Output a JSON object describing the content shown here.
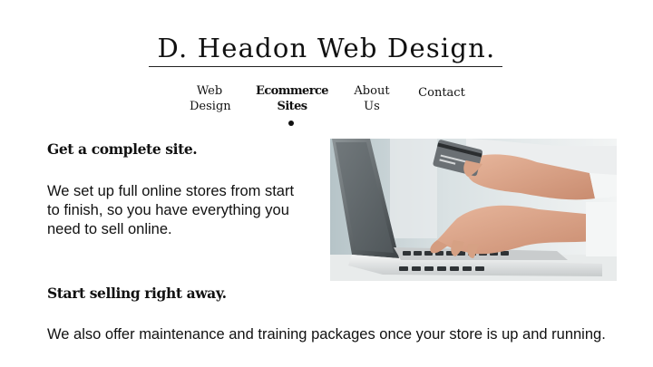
{
  "site": {
    "title": "D. Headon Web Design."
  },
  "nav": {
    "items": [
      {
        "label_line1": "Web",
        "label_line2": "Design",
        "active": false
      },
      {
        "label_line1": "Ecommerce",
        "label_line2": "Sites",
        "active": true
      },
      {
        "label_line1": "About",
        "label_line2": "Us",
        "active": false
      },
      {
        "label_line1": "Contact",
        "label_line2": "",
        "active": false
      }
    ]
  },
  "content": {
    "section1": {
      "heading": "Get a complete site.",
      "body": "We set up full online stores from start to finish, so you have everything you need to sell online."
    },
    "section2": {
      "heading": "Start selling right away.",
      "body": "We also offer maintenance and training packages once your store is up and running."
    }
  },
  "image": {
    "subject": "hands-typing-on-laptop-holding-credit-card"
  }
}
